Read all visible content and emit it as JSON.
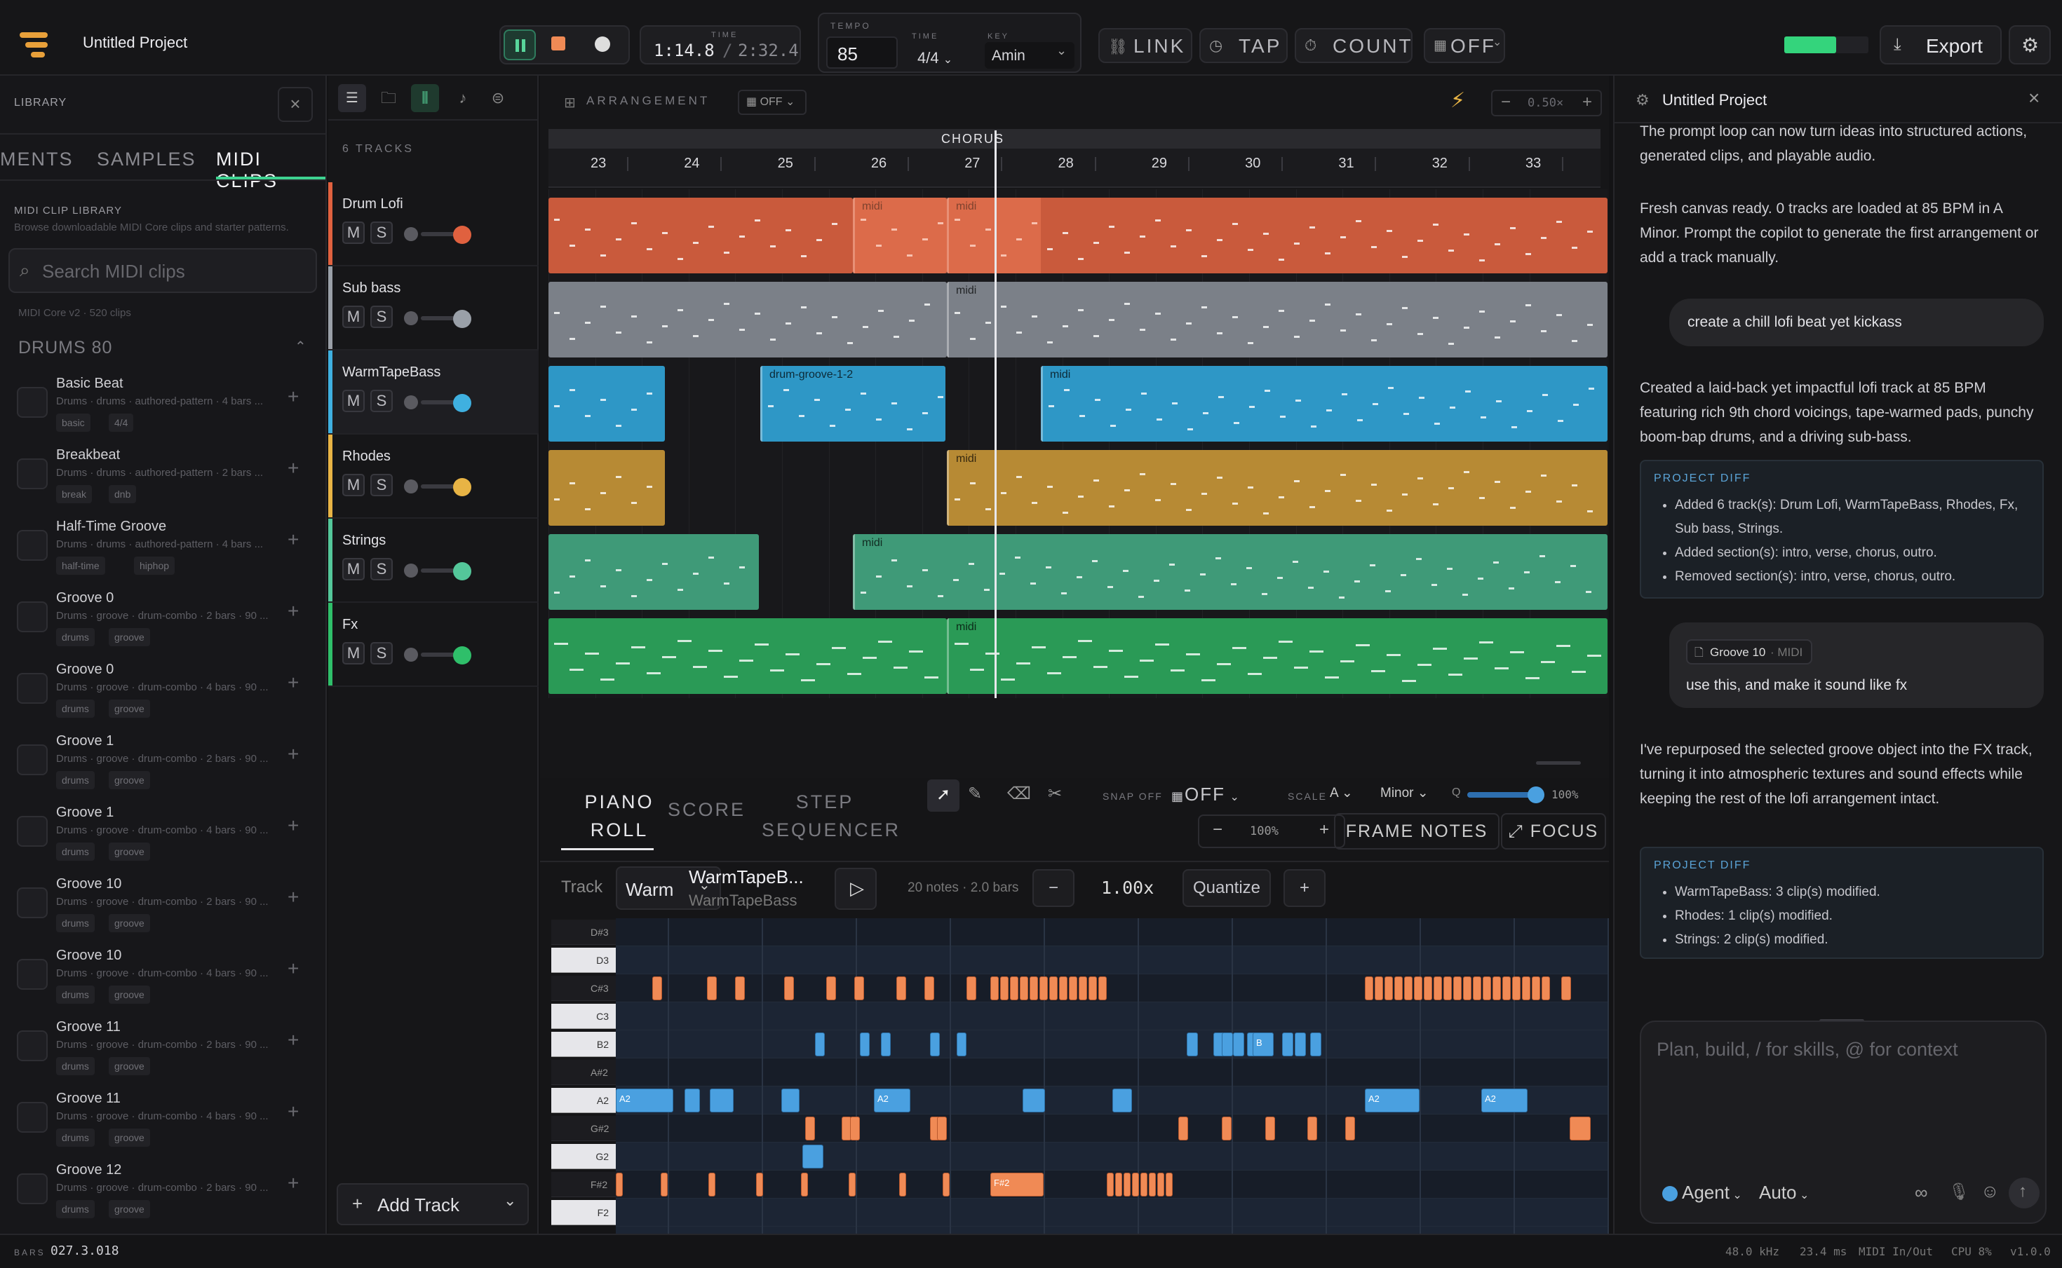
{
  "app": {
    "project_title": "Untitled Project"
  },
  "transport": {
    "time_label": "TIME",
    "time_current": "1:14.8",
    "time_sep": "/",
    "time_total": "2:32.4",
    "tempo_label": "TEMPO",
    "tempo_value": "85",
    "sig_label": "TIME",
    "sig_value": "4/4",
    "key_label": "KEY",
    "key_value": "Amin",
    "link": "LINK",
    "tap": "TAP",
    "count": "COUNT",
    "off": "OFF",
    "export": "Export"
  },
  "library": {
    "title": "LIBRARY",
    "tabs": [
      "MENTS",
      "SAMPLES",
      "MIDI CLIPS"
    ],
    "section_title": "MIDI CLIP LIBRARY",
    "section_sub": "Browse downloadable MIDI Core clips and starter patterns.",
    "search_placeholder": "Search MIDI clips",
    "meta": "MIDI Core v2 · 520 clips",
    "group": "DRUMS 80",
    "items": [
      {
        "title": "Basic Beat",
        "sub": "Drums · drums · authored-pattern · 4 bars ...",
        "tags": [
          "basic",
          "4/4"
        ]
      },
      {
        "title": "Breakbeat",
        "sub": "Drums · drums · authored-pattern · 2 bars ...",
        "tags": [
          "break",
          "dnb"
        ]
      },
      {
        "title": "Half-Time Groove",
        "sub": "Drums · drums · authored-pattern · 4 bars ...",
        "tags": [
          "half-time",
          "hiphop"
        ]
      },
      {
        "title": "Groove 0",
        "sub": "Drums · groove · drum-combo · 2 bars · 90 ...",
        "tags": [
          "drums",
          "groove"
        ]
      },
      {
        "title": "Groove 0",
        "sub": "Drums · groove · drum-combo · 4 bars · 90 ...",
        "tags": [
          "drums",
          "groove"
        ]
      },
      {
        "title": "Groove 1",
        "sub": "Drums · groove · drum-combo · 2 bars · 90 ...",
        "tags": [
          "drums",
          "groove"
        ]
      },
      {
        "title": "Groove 1",
        "sub": "Drums · groove · drum-combo · 4 bars · 90 ...",
        "tags": [
          "drums",
          "groove"
        ]
      },
      {
        "title": "Groove 10",
        "sub": "Drums · groove · drum-combo · 2 bars · 90 ...",
        "tags": [
          "drums",
          "groove"
        ]
      },
      {
        "title": "Groove 10",
        "sub": "Drums · groove · drum-combo · 4 bars · 90 ...",
        "tags": [
          "drums",
          "groove"
        ]
      },
      {
        "title": "Groove 11",
        "sub": "Drums · groove · drum-combo · 2 bars · 90 ...",
        "tags": [
          "drums",
          "groove"
        ]
      },
      {
        "title": "Groove 11",
        "sub": "Drums · groove · drum-combo · 4 bars · 90 ...",
        "tags": [
          "drums",
          "groove"
        ]
      },
      {
        "title": "Groove 12",
        "sub": "Drums · groove · drum-combo · 2 bars · 90 ...",
        "tags": [
          "drums",
          "groove"
        ]
      }
    ]
  },
  "tracks": {
    "count_label": "6 TRACKS",
    "add_label": "Add Track",
    "list": [
      {
        "name": "Drum Lofi",
        "color": "#e0613f"
      },
      {
        "name": "Sub bass",
        "color": "#9aa0a8"
      },
      {
        "name": "WarmTapeBass",
        "color": "#3fb0e0"
      },
      {
        "name": "Rhodes",
        "color": "#e8b445"
      },
      {
        "name": "Strings",
        "color": "#54c79a"
      },
      {
        "name": "Fx",
        "color": "#2fbf6a"
      }
    ],
    "m": "M",
    "s": "S"
  },
  "arrangement": {
    "label": "ARRANGEMENT",
    "snap": "OFF",
    "zoom": "0.50×",
    "section": "CHORUS",
    "bars": [
      "23",
      "24",
      "25",
      "26",
      "27",
      "28",
      "29",
      "30",
      "31",
      "32",
      "33"
    ],
    "clip_midi": "midi",
    "clip_groove": "drum-groove-1-2"
  },
  "editor": {
    "tabs": [
      "PIANO ROLL",
      "SCORE",
      "STEP SEQUENCER"
    ],
    "snap_label": "SNAP OFF",
    "snap_value": "OFF",
    "scale_label": "SCALE",
    "scale_root": "A",
    "scale_mode": "Minor",
    "q_label": "Q",
    "q_value": "100%",
    "zoom": "100%",
    "frame_notes": "FRAME NOTES",
    "focus": "FOCUS",
    "track_label": "Track",
    "track_select": "Warm",
    "track_name": "WarmTapeB...",
    "track_sub": "WarmTapeBass",
    "note_info": "20 notes · 2.0 bars",
    "speed": "1.00x",
    "quantize": "Quantize",
    "keys": [
      "D#3",
      "D3",
      "C#3",
      "C3",
      "B2",
      "A#2",
      "A2",
      "G#2",
      "G2",
      "F#2",
      "F2"
    ],
    "note_label_a2": "A2",
    "note_label_b": "B",
    "note_label_fs2": "F#2"
  },
  "chat": {
    "title": "Untitled Project",
    "msg1": "The prompt loop can now turn ideas into structured actions, generated clips, and playable audio.",
    "msg2": "Fresh canvas ready. 0 tracks are loaded at 85 BPM in A Minor. Prompt the copilot to generate the first arrangement or add a track manually.",
    "user1": "create a chill lofi beat yet kickass",
    "msg3": "Created a laid-back yet impactful lofi track at 85 BPM featuring rich 9th chord voicings, tape-warmed pads, punchy boom-bap drums, and a driving sub-bass.",
    "diff_label": "PROJECT DIFF",
    "diff1": [
      "Added 6 track(s): Drum Lofi, WarmTapeBass, Rhodes, Fx, Sub bass, Strings.",
      "Added section(s): intro, verse, chorus, outro.",
      "Removed section(s): intro, verse, chorus, outro."
    ],
    "attach_name": "Groove 10",
    "attach_type": "· MIDI",
    "user2": "use this, and make it sound like fx",
    "msg4": "I've repurposed the selected groove object into the FX track, turning it into atmospheric textures and sound effects while keeping the rest of the lofi arrangement intact.",
    "diff2": [
      "WarmTapeBass: 3 clip(s) modified.",
      "Rhodes: 1 clip(s) modified.",
      "Strings: 2 clip(s) modified."
    ],
    "input_placeholder": "Plan, build, / for skills, @ for context",
    "agent": "Agent",
    "auto": "Auto"
  },
  "status": {
    "bars_label": "BARS",
    "bars_value": "027.3.018",
    "rate": "48.0 kHz",
    "latency": "23.4 ms",
    "midi": "MIDI In/Out",
    "cpu": "CPU 8%",
    "version": "v1.0.0"
  }
}
